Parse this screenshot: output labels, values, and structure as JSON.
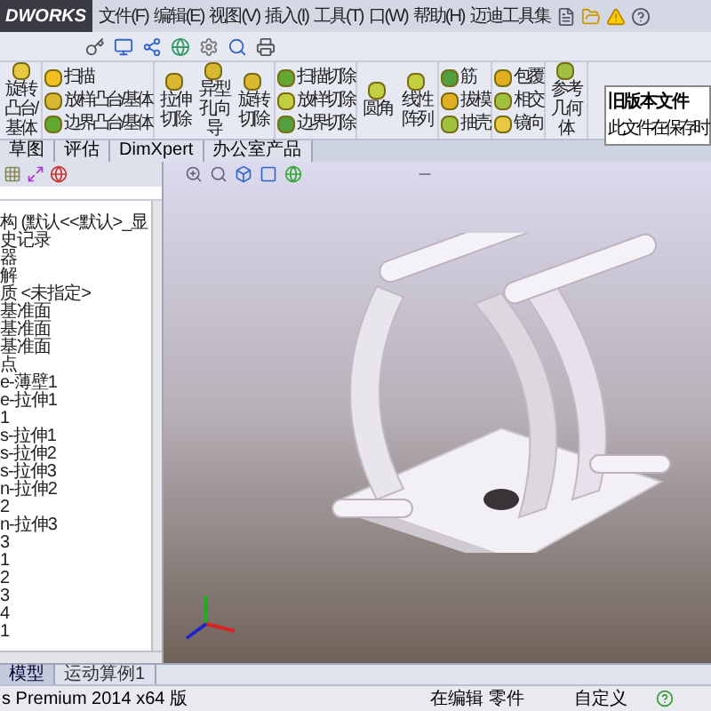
{
  "title_bar": {
    "logo": "DWORKS",
    "menu": [
      "文件(F)",
      "编辑(E)",
      "视图(V)",
      "插入(I)",
      "工具(T)",
      "口(W)",
      "帮助(H)",
      "迈迪工具集"
    ]
  },
  "ribbon": {
    "groups": [
      {
        "items": [
          {
            "label": "旋转凸台/基体",
            "kind": "large"
          }
        ]
      },
      {
        "items": [
          {
            "label": "扫描",
            "kind": "small"
          },
          {
            "label": "放样凸台/基体",
            "kind": "small"
          },
          {
            "label": "边界凸台/基体",
            "kind": "small"
          }
        ]
      },
      {
        "items": [
          {
            "label": "拉伸切除",
            "kind": "large"
          },
          {
            "label": "异型孔向导",
            "kind": "large"
          },
          {
            "label": "旋转切除",
            "kind": "large"
          }
        ]
      },
      {
        "items": [
          {
            "label": "扫描切除",
            "kind": "small"
          },
          {
            "label": "放样切除",
            "kind": "small"
          },
          {
            "label": "边界切除",
            "kind": "small"
          }
        ]
      },
      {
        "items": [
          {
            "label": "圆角",
            "kind": "large"
          },
          {
            "label": "线性阵列",
            "kind": "large"
          }
        ]
      },
      {
        "items": [
          {
            "label": "筋",
            "kind": "small"
          },
          {
            "label": "拔模",
            "kind": "small"
          },
          {
            "label": "抽壳",
            "kind": "small"
          }
        ]
      },
      {
        "items": [
          {
            "label": "包覆",
            "kind": "small"
          },
          {
            "label": "相交",
            "kind": "small"
          },
          {
            "label": "镜向",
            "kind": "small"
          }
        ]
      },
      {
        "items": [
          {
            "label": "参考几何体",
            "kind": "large"
          }
        ]
      }
    ]
  },
  "tooltip": {
    "title": "旧版本文件",
    "text": "此文件在保存时"
  },
  "tabs": [
    {
      "label": "草图",
      "selected": false
    },
    {
      "label": "评估",
      "selected": false
    },
    {
      "label": "DimXpert",
      "selected": false
    },
    {
      "label": "办公室产品",
      "selected": false
    }
  ],
  "tree": {
    "items": [
      "构 (默认<<默认>_显",
      "史记录",
      "器",
      "解",
      "质 <未指定>",
      "基准面",
      "基准面",
      "基准面",
      "点",
      "e-薄壁1",
      "e-拉伸1",
      "1",
      "s-拉伸1",
      "s-拉伸2",
      "s-拉伸3",
      "n-拉伸2",
      "2",
      "n-拉伸3",
      "3",
      "1",
      "2",
      "3",
      "4",
      "1"
    ]
  },
  "bottom_tabs": [
    {
      "label": "模型",
      "selected": true
    },
    {
      "label": "运动算例1",
      "selected": false
    }
  ],
  "status_bar": {
    "product": "s Premium 2014 x64 版",
    "mode": "在编辑 零件",
    "units": "自定义"
  }
}
